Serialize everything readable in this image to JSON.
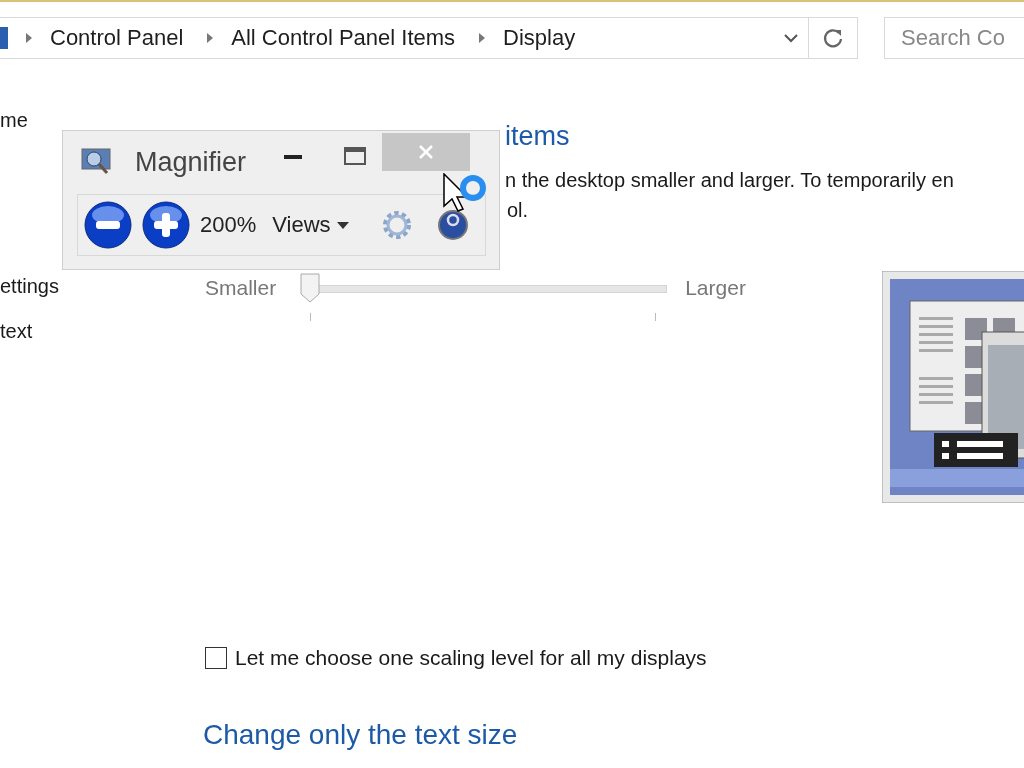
{
  "address_bar": {
    "breadcrumbs": [
      {
        "label": "Control Panel"
      },
      {
        "label": "All Control Panel Items"
      },
      {
        "label": "Display"
      }
    ],
    "search": {
      "placeholder": "Search Co"
    }
  },
  "sidebar": {
    "items": [
      {
        "label": "me"
      },
      {
        "label": "ettings"
      },
      {
        "label": "text"
      }
    ]
  },
  "main": {
    "heading": "items",
    "description": [
      "n the desktop smaller and larger. To temporarily en",
      "ol."
    ],
    "slider": {
      "min_label": "Smaller",
      "max_label": "Larger",
      "level": 0
    },
    "scaling_checkbox": {
      "label": "Let me choose one scaling level for all my displays",
      "checked": false
    },
    "text_size_heading": "Change only the text size"
  },
  "magnifier": {
    "title": "Magnifier",
    "zoom": "200%",
    "views": "Views"
  }
}
